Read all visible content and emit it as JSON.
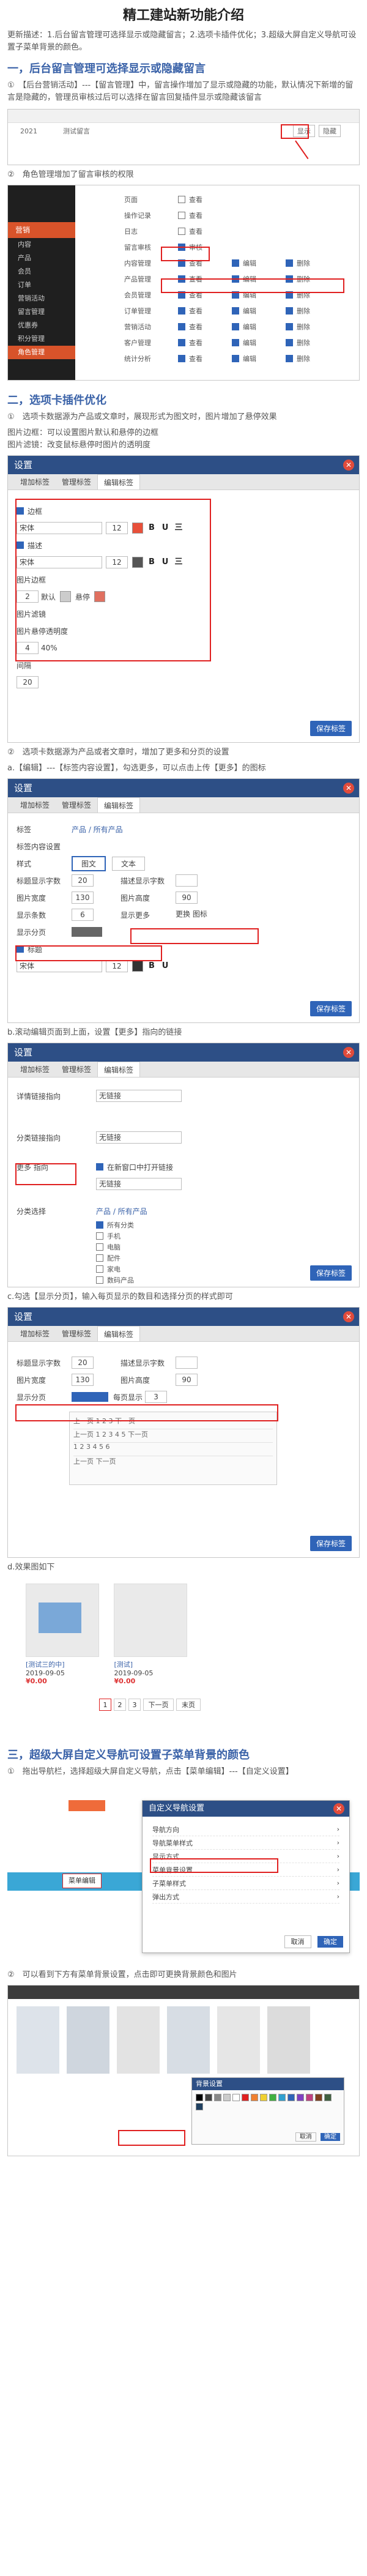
{
  "title": "精工建站新功能介绍",
  "intro": "更新描述：1.后台留言管理可选择显示或隐藏留言；2.选项卡插件优化；3.超级大屏自定义导航可设置子菜单背景的颜色。",
  "section1": {
    "heading": "一，后台留言管理可选择显示或隐藏留言",
    "step1": "①　【后台营销活动】---【留言管理】中，留言操作增加了显示或隐藏的功能，默认情况下新增的留言是隐藏的，管理员审核过后可以选择在留言回复插件显示或隐藏该留言",
    "step2": "②　角色管理增加了留言审核的权限",
    "shot1": {
      "cols": [
        "2021",
        "",
        "测试留言",
        "",
        "",
        "",
        "",
        ""
      ],
      "buttons": [
        "显示",
        "隐藏"
      ]
    },
    "shot2": {
      "side_head": "营销",
      "side_items": [
        "内容",
        "产品",
        "会员",
        "订单",
        "营销活动",
        "留言管理",
        "优惠券",
        "积分管理",
        "客户管理",
        "角色管理"
      ],
      "perm_rows": [
        {
          "label": "页面",
          "opts": [
            "查看"
          ]
        },
        {
          "label": "操作记录",
          "opts": [
            "查看"
          ]
        },
        {
          "label": "日志",
          "opts": [
            "查看"
          ]
        },
        {
          "label": "留言审核",
          "opts": [
            "审核"
          ]
        },
        {
          "label": "内容管理",
          "opts": [
            "查看",
            "编辑",
            "删除"
          ]
        },
        {
          "label": "产品管理",
          "opts": [
            "查看",
            "编辑",
            "删除"
          ]
        },
        {
          "label": "会员管理",
          "opts": [
            "查看",
            "编辑",
            "删除"
          ]
        },
        {
          "label": "订单管理",
          "opts": [
            "查看",
            "编辑",
            "删除"
          ]
        },
        {
          "label": "营销活动",
          "opts": [
            "查看",
            "编辑",
            "删除"
          ]
        },
        {
          "label": "客户管理",
          "opts": [
            "查看",
            "编辑",
            "删除"
          ]
        },
        {
          "label": "统计分析",
          "opts": [
            "查看",
            "编辑",
            "删除"
          ]
        }
      ]
    }
  },
  "section2": {
    "heading": "二，选项卡插件优化",
    "step1": "①　选项卡数据源为产品或文章时，展现形式为图文时，图片增加了悬停效果",
    "step1b": "图片边框：可以设置图片默认和悬停的边框",
    "step1c": "图片滤镜：改变鼠标悬停时图片的透明度",
    "step2": "②　选项卡数据源为产品或者文章时，增加了更多和分页的设置",
    "step2a": "a.【编辑】---【标签内容设置】，勾选更多，可以点击上传【更多】的图标",
    "step2b": "b.滚动编辑页面到上面，设置【更多】指向的链接",
    "step2c": "c.勾选【显示分页】，输入每页显示的数目和选择分页的样式即可",
    "step2d": "d.效果图如下",
    "dlg": {
      "title": "设置",
      "tabs": [
        "增加标签",
        "管理标签",
        "编辑标签"
      ],
      "save": "保存标签",
      "font": "宋体",
      "size": "12",
      "bold": "B",
      "underline": "U",
      "strike": "三",
      "chk_border": "边框",
      "chk_hover": "描述",
      "img_border": "图片边框",
      "default": "默认",
      "hover": "悬停",
      "img_filter": "图片滤镜",
      "opacity_label": "图片悬停透明度",
      "opacity_val": "4",
      "pct": "40%",
      "duration": "间隔",
      "duration_val": "20"
    },
    "dlg2": {
      "label_title": "标签",
      "datasource": "产品 / 所有产品",
      "style_label": "样式",
      "style_opts": [
        "图文",
        "文本"
      ],
      "rows": [
        [
          "标题显示字数",
          "20",
          "描述显示字数",
          ""
        ],
        [
          "图片宽度",
          "130",
          "图片高度",
          "90"
        ],
        [
          "显示条数",
          "6",
          "显示更多",
          "更换 图标"
        ]
      ],
      "paging": "显示分页",
      "section_label": "标签内容设置",
      "title_label": "标题"
    },
    "dlg3": {
      "rows": [
        [
          "详情链接指向",
          "无链接"
        ],
        [
          "分类链接指向",
          "无链接"
        ]
      ],
      "more_label": "更多 指向",
      "link_new": "在新窗口中打开链接",
      "link_none": "无链接",
      "cat_label": "分类选择",
      "cats": [
        "所有分类",
        "手机",
        "电脑",
        "配件",
        "家电",
        "数码产品"
      ]
    },
    "dlg4": {
      "paging_label": "显示分页",
      "per_page": "每页显示",
      "per_page_val": "3",
      "prev": "上一页",
      "next": "下一页"
    },
    "products": [
      {
        "name": "[测试三的中]",
        "date": "2019-09-05",
        "price": "¥0.00"
      },
      {
        "name": "[测试]",
        "date": "2019-09-05",
        "price": "¥0.00"
      }
    ],
    "pager": [
      "1",
      "2",
      "3",
      "下一页",
      "末页"
    ]
  },
  "section3": {
    "heading": "三，超级大屏自定义导航可设置子菜单背景的颜色",
    "step1": "①　拖出导航栏，选择超级大屏自定义导航，点击【菜单编辑】---【自定义设置】",
    "step2": "②　可以看到下方有菜单背景设置，点击即可更换背景颜色和图片",
    "menu_dlg": {
      "title": "自定义导航设置",
      "items": [
        "导航方向",
        "导航菜单样式",
        "显示方式",
        "菜单背景设置",
        "子菜单样式",
        "弹出方式"
      ],
      "btn_cancel": "取消",
      "btn_ok": "确定"
    },
    "nav_label": "菜单编辑",
    "color_dlg": {
      "title": "背景设置",
      "ok": "确定",
      "cancel": "取消"
    }
  },
  "colors": {
    "accent": "#3a62a8",
    "red": "#e02020",
    "dlg_title": "#2d4f86",
    "orange": "#d8532a"
  }
}
